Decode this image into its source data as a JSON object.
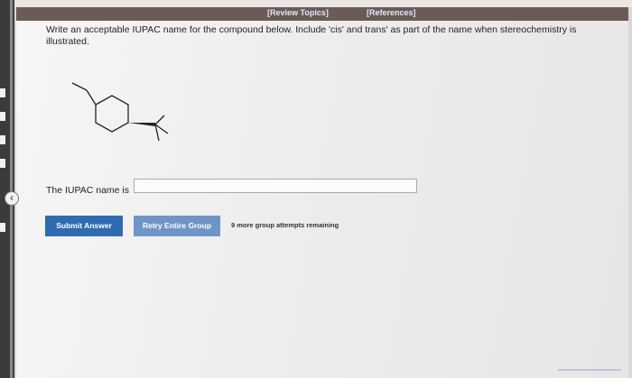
{
  "header": {
    "review_topics": "[Review Topics]",
    "references": "[References]"
  },
  "question": {
    "prompt": "Write an acceptable IUPAC name for the compound below. Include 'cis' and trans' as part of the name when stereochemistry is illustrated."
  },
  "answer": {
    "label": "The IUPAC name is",
    "value": "",
    "placeholder": ""
  },
  "actions": {
    "submit_label": "Submit Answer",
    "retry_label": "Retry Entire Group",
    "attempts_text": "9 more group attempts remaining"
  },
  "sidebar": {
    "collapse_glyph": "‹"
  },
  "colors": {
    "submit": "#2f6bb0",
    "retry": "#6f95c7",
    "header_bar": "#6b5a55"
  }
}
